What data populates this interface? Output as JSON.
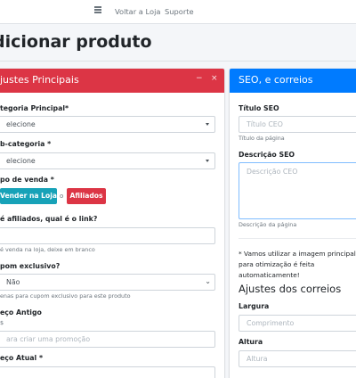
{
  "topbar": {
    "menu_icon": "hamburger-icon",
    "links": [
      "Voltar a Loja",
      "Suporte"
    ]
  },
  "page": {
    "title": "dicionar produto"
  },
  "main_card": {
    "title": "justes Principais",
    "accent": "#dc3545",
    "tools": {
      "minimize": "−",
      "close": "×"
    },
    "category": {
      "label": "tegoria Principal*",
      "value": "elecione"
    },
    "subcategory": {
      "label": "b-categoria *",
      "value": "elecione"
    },
    "sale_type": {
      "label": "po de venda *",
      "btn_store": "Vender na Loja",
      "separator": "o",
      "btn_affiliate": "Afiliados"
    },
    "affiliate_link": {
      "label": "é afiliados, qual é o link?",
      "value": "",
      "help": "é venda na loja, deixe em branco"
    },
    "coupon": {
      "label": "pom exclusivo?",
      "value": "Não",
      "help": "enas para cupom exclusivo para este produto"
    },
    "old_price": {
      "label": "eço Antigo",
      "prefix": "$",
      "placeholder": "ara criar uma promoção"
    },
    "current_price": {
      "label": "eço Atual *"
    }
  },
  "seo_card": {
    "title": "SEO, e correios",
    "accent": "#007bff",
    "seo_title": {
      "label": "Título SEO",
      "placeholder": "Título CEO",
      "help": "Título da página"
    },
    "seo_desc": {
      "label": "Descrição SEO",
      "placeholder": "Descrição CEO",
      "help": "Descrição da página"
    },
    "note": "* Vamos utilizar a imagem principal para otimização é feita automaticamente!",
    "shipping": {
      "title": "Ajustes dos correios",
      "width": {
        "label": "Largura",
        "placeholder": "Comprimento"
      },
      "height": {
        "label": "Altura",
        "placeholder": "Altura"
      }
    }
  }
}
